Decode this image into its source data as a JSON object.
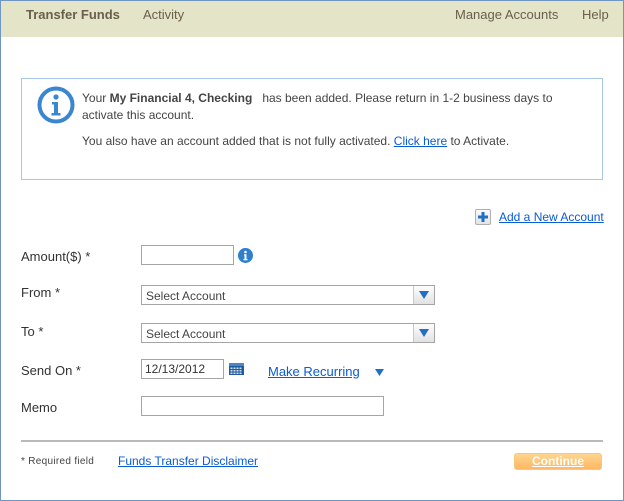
{
  "topnav": {
    "left": [
      {
        "label": "Transfer Funds",
        "active": true
      },
      {
        "label": "Activity",
        "active": false
      }
    ],
    "right": [
      {
        "label": "Manage Accounts"
      },
      {
        "label": "Help"
      }
    ]
  },
  "notice": {
    "icon": "info-icon",
    "line1_prefix": "Your ",
    "account_name": "My Financial 4, Checking",
    "line1_suffix": "has been added. Please return in 1-2 business days to",
    "line2": "activate this account.",
    "line3_prefix": "You also have an account added that is not fully activated. ",
    "line3_link": "Click here",
    "line3_suffix": " to Activate."
  },
  "add_account": {
    "icon": "plus-icon",
    "label": "Add a New Account"
  },
  "form": {
    "amount": {
      "label": "Amount($)  *",
      "value": "",
      "help_icon": "info-icon"
    },
    "from": {
      "label": "From  *",
      "selected": "Select Account"
    },
    "to": {
      "label": "To  *",
      "selected": "Select Account"
    },
    "send_on": {
      "label": "Send On  *",
      "value": "12/13/2012",
      "calendar_icon": "calendar-icon"
    },
    "recurring": {
      "label": "Make Recurring",
      "icon": "dropdown-triangle-icon"
    },
    "memo": {
      "label": "Memo",
      "value": ""
    }
  },
  "footer": {
    "required_note": "* Required field",
    "disclaimer_link": "Funds Transfer Disclaimer",
    "continue_label": "Continue"
  },
  "colors": {
    "nav_bg": "#e4e4c8",
    "link": "#0a5bd6",
    "accent_blue": "#3b87cf",
    "continue_btn": "#ffc477"
  }
}
